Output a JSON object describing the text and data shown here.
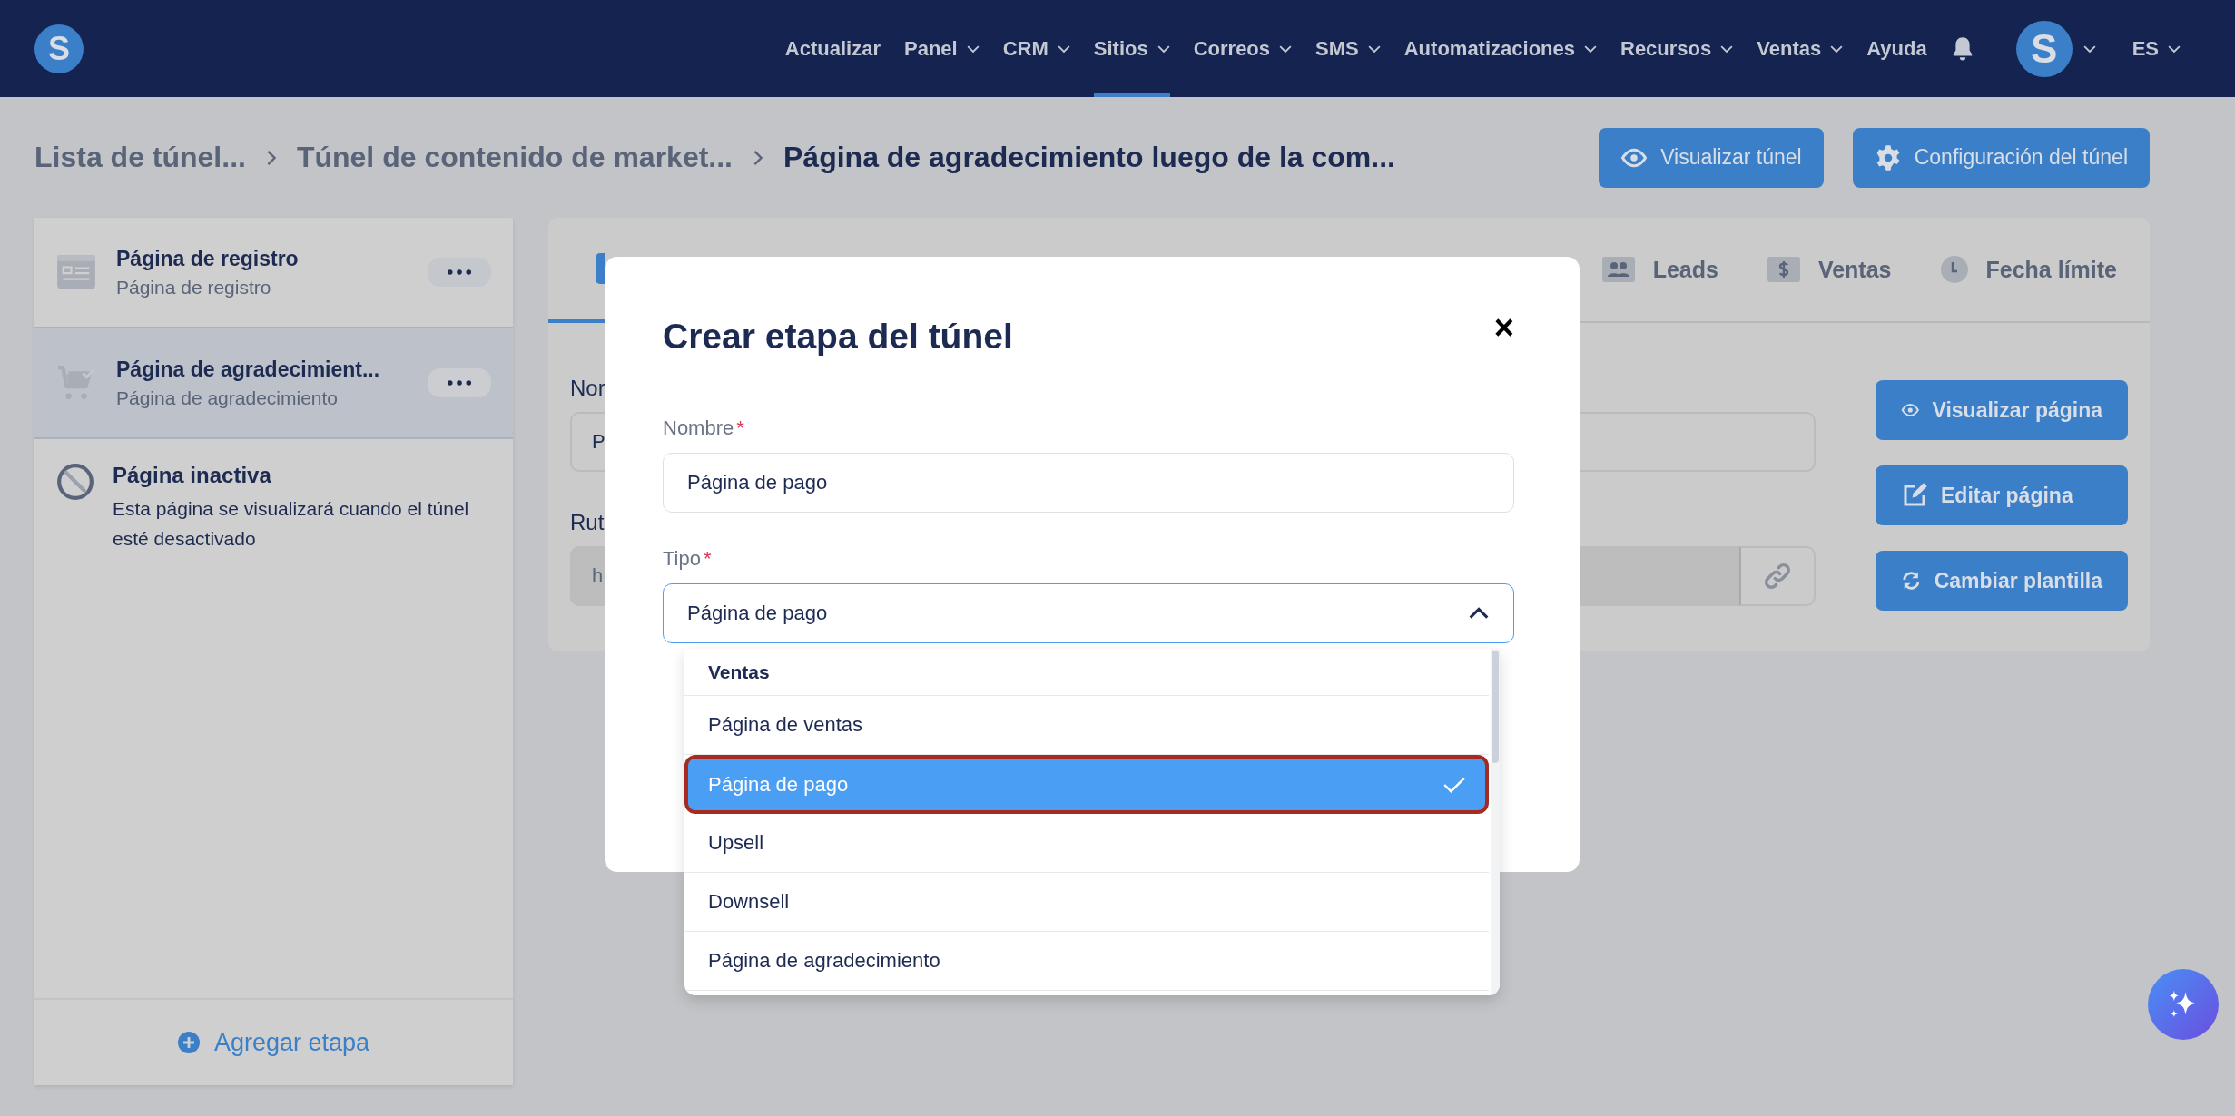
{
  "nav": {
    "logo": "S",
    "items": [
      {
        "label": "Actualizar",
        "dropdown": false,
        "selected": false
      },
      {
        "label": "Panel",
        "dropdown": true,
        "selected": false
      },
      {
        "label": "CRM",
        "dropdown": true,
        "selected": false
      },
      {
        "label": "Sitios",
        "dropdown": true,
        "selected": true
      },
      {
        "label": "Correos",
        "dropdown": true,
        "selected": false
      },
      {
        "label": "SMS",
        "dropdown": true,
        "selected": false
      },
      {
        "label": "Automatizaciones",
        "dropdown": true,
        "selected": false
      },
      {
        "label": "Recursos",
        "dropdown": true,
        "selected": false
      },
      {
        "label": "Ventas",
        "dropdown": true,
        "selected": false
      },
      {
        "label": "Ayuda",
        "dropdown": false,
        "selected": false
      }
    ],
    "avatar": "S",
    "language": "ES"
  },
  "breadcrumb": [
    "Lista de túnel...",
    "Túnel de contenido de market...",
    "Página de agradecimiento luego de la com..."
  ],
  "actions": [
    {
      "label": "Visualizar túnel",
      "kind": "eye"
    },
    {
      "label": "Configuración del túnel",
      "kind": "gear"
    }
  ],
  "steps": [
    {
      "title": "Página de registro",
      "subtitle": "Página de registro",
      "kind": "form",
      "selected": false
    },
    {
      "title": "Página de agradecimient...",
      "subtitle": "Página de agradecimiento",
      "kind": "cart",
      "selected": true
    }
  ],
  "inactive": {
    "title": "Página inactiva",
    "description": "Esta página se visualizará cuando el túnel esté desactivado"
  },
  "add_step": "Agregar etapa",
  "editor": {
    "tabs": [
      {
        "label": "Leads",
        "kind": "people"
      },
      {
        "label": "Ventas",
        "kind": "dollar"
      },
      {
        "label": "Fecha límite",
        "kind": "clock"
      }
    ],
    "name_label": "Nor",
    "name_value": "P",
    "route_label": "Rut",
    "route_value": "h",
    "buttons": [
      {
        "label": "Visualizar página",
        "kind": "eye"
      },
      {
        "label": "Editar página",
        "kind": "edit"
      },
      {
        "label": "Cambiar plantilla",
        "kind": "refresh"
      }
    ]
  },
  "modal": {
    "title": "Crear etapa del túnel",
    "close": "×",
    "name_label": "Nombre",
    "name_value": "Página de pago",
    "type_label": "Tipo",
    "type_value": "Página de pago",
    "required": "*",
    "dropdown": {
      "group": "Ventas",
      "options": [
        {
          "label": "Página de ventas",
          "selected": false
        },
        {
          "label": "Página de pago",
          "selected": true
        },
        {
          "label": "Upsell",
          "selected": false
        },
        {
          "label": "Downsell",
          "selected": false
        },
        {
          "label": "Página de agradecimiento",
          "selected": false
        }
      ]
    }
  }
}
